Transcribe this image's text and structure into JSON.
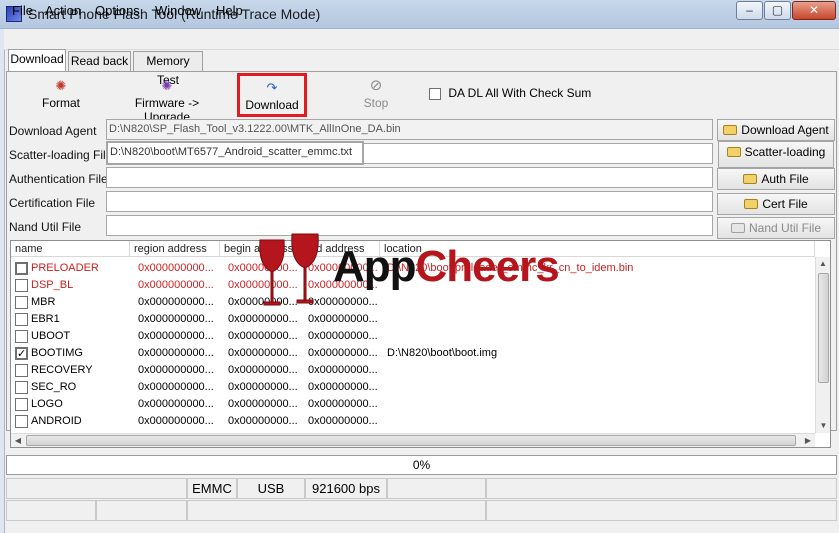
{
  "window": {
    "title": "Smart Phone Flash Tool (Runtime Trace Mode)"
  },
  "menu": {
    "items": [
      "File",
      "Action",
      "Options",
      "Window",
      "Help"
    ]
  },
  "tabs": [
    "Download",
    "Read back",
    "Memory Test"
  ],
  "toolbar": {
    "format": "Format",
    "firmware_upgrade": "Firmware -> Upgrade",
    "download": "Download",
    "stop": "Stop",
    "checksum_label": "DA DL All With Check Sum"
  },
  "fields": [
    {
      "label": "Download Agent",
      "value": "D:\\N820\\SP_Flash_Tool_v3.1222.00\\MTK_AllInOne_DA.bin",
      "button": "Download Agent"
    },
    {
      "label": "Scatter-loading File",
      "value": "D:\\N820\\boot\\MT6577_Android_scatter_emmc.txt",
      "button": "Scatter-loading"
    },
    {
      "label": "Authentication File",
      "value": "",
      "button": "Auth File"
    },
    {
      "label": "Certification File",
      "value": "",
      "button": "Cert File"
    },
    {
      "label": "Nand Util File",
      "value": "",
      "button": "Nand Util File"
    }
  ],
  "list": {
    "headers": [
      "name",
      "region address",
      "begin address",
      "end address",
      "location"
    ],
    "rows": [
      {
        "name": "PRELOADER",
        "region": "0x000000000...",
        "begin": "0x00000000...",
        "end": "0x00000000...",
        "location": "D:\\N820\\boot\\preloader_emmc_kr_cn_to_idem.bin",
        "checked": false
      },
      {
        "name": "DSP_BL",
        "region": "0x000000000...",
        "begin": "0x00000000...",
        "end": "0x00000000...",
        "location": "",
        "checked": false
      },
      {
        "name": "MBR",
        "region": "0x000000000...",
        "begin": "0x00000000...",
        "end": "0x00000000...",
        "location": "",
        "checked": false
      },
      {
        "name": "EBR1",
        "region": "0x000000000...",
        "begin": "0x00000000...",
        "end": "0x00000000...",
        "location": "",
        "checked": false
      },
      {
        "name": "UBOOT",
        "region": "0x000000000...",
        "begin": "0x00000000...",
        "end": "0x00000000...",
        "location": "",
        "checked": false
      },
      {
        "name": "BOOTIMG",
        "region": "0x000000000...",
        "begin": "0x00000000...",
        "end": "0x00000000...",
        "location": "D:\\N820\\boot\\boot.img",
        "checked": true
      },
      {
        "name": "RECOVERY",
        "region": "0x000000000...",
        "begin": "0x00000000...",
        "end": "0x00000000...",
        "location": "",
        "checked": false
      },
      {
        "name": "SEC_RO",
        "region": "0x000000000...",
        "begin": "0x00000000...",
        "end": "0x00000000...",
        "location": "",
        "checked": false
      },
      {
        "name": "LOGO",
        "region": "0x000000000...",
        "begin": "0x00000000...",
        "end": "0x00000000...",
        "location": "",
        "checked": false
      },
      {
        "name": "ANDROID",
        "region": "0x000000000...",
        "begin": "0x00000000...",
        "end": "0x00000000...",
        "location": "",
        "checked": false
      }
    ]
  },
  "progress": {
    "percent": 0,
    "label": "0%"
  },
  "status": {
    "storage": "EMMC",
    "port": "USB",
    "baud": "921600 bps"
  },
  "watermark": {
    "brand_prefix": "App",
    "brand_suffix": "Cheers"
  },
  "colors": {
    "highlight": "#e11b22",
    "red_text": "#cc1f1f",
    "watermark_red": "#b5151c"
  }
}
